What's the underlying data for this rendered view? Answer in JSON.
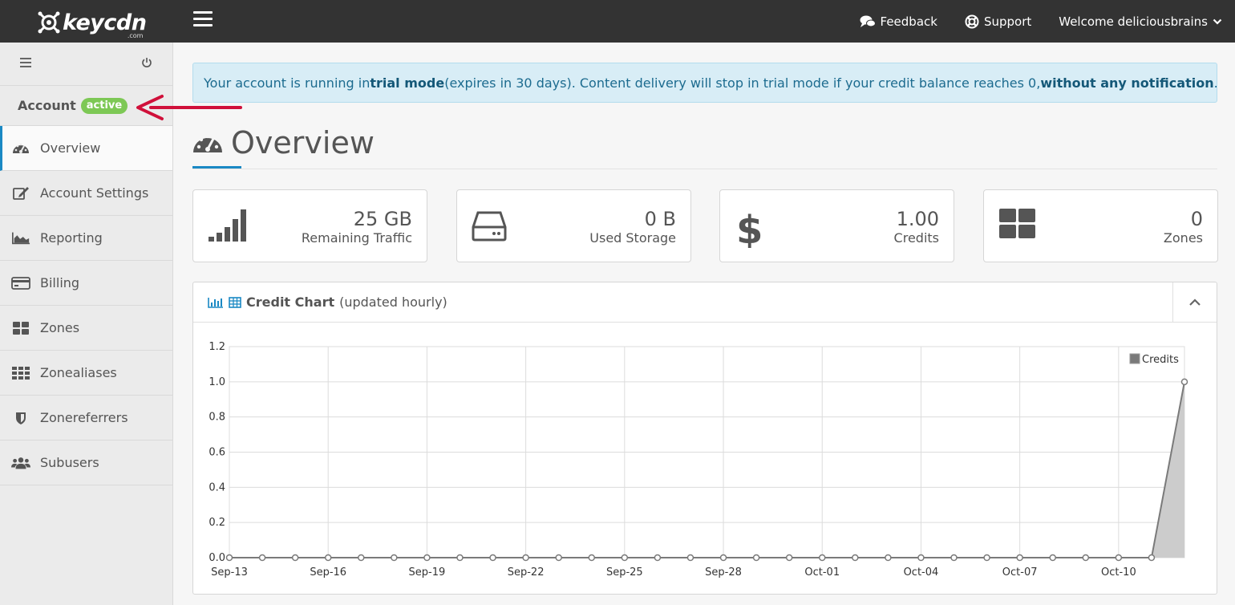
{
  "topbar": {
    "logo_text": "keycdn",
    "logo_sub": ".com",
    "feedback": "Feedback",
    "support": "Support",
    "welcome": "Welcome deliciousbrains"
  },
  "sidebar": {
    "account_label": "Account",
    "account_status": "active",
    "items": [
      {
        "label": "Overview",
        "icon": "dashboard-icon"
      },
      {
        "label": "Account Settings",
        "icon": "edit-icon"
      },
      {
        "label": "Reporting",
        "icon": "area-chart-icon"
      },
      {
        "label": "Billing",
        "icon": "credit-card-icon"
      },
      {
        "label": "Zones",
        "icon": "grid-icon"
      },
      {
        "label": "Zonealiases",
        "icon": "grid-dots-icon"
      },
      {
        "label": "Zonereferrers",
        "icon": "shield-icon"
      },
      {
        "label": "Subusers",
        "icon": "users-icon"
      }
    ]
  },
  "alert": {
    "p1": "Your account is running in ",
    "b1": "trial mode",
    "p2": " (expires in 30 days). Content delivery will stop in trial mode if your credit balance reaches 0, ",
    "b2": "without any notification",
    "p3": "."
  },
  "page": {
    "title": "Overview"
  },
  "stats": [
    {
      "value": "25 GB",
      "label": "Remaining Traffic",
      "icon": "signal-bars-icon"
    },
    {
      "value": "0 B",
      "label": "Used Storage",
      "icon": "hard-drive-icon"
    },
    {
      "value": "1.00",
      "label": "Credits",
      "icon": "dollar-icon"
    },
    {
      "value": "0",
      "label": "Zones",
      "icon": "zones-grid-icon"
    }
  ],
  "chart_panel": {
    "title": "Credit Chart",
    "subtitle": "(updated hourly)"
  },
  "chart_data": {
    "type": "area",
    "series": [
      {
        "name": "Credits",
        "values": [
          0,
          0,
          0,
          0,
          0,
          0,
          0,
          0,
          0,
          0,
          0,
          0,
          0,
          0,
          0,
          0,
          0,
          0,
          0,
          0,
          0,
          0,
          0,
          0,
          0,
          0,
          0,
          0,
          0,
          1.0
        ]
      }
    ],
    "x": [
      "Sep-13",
      "Sep-14",
      "Sep-15",
      "Sep-16",
      "Sep-17",
      "Sep-18",
      "Sep-19",
      "Sep-20",
      "Sep-21",
      "Sep-22",
      "Sep-23",
      "Sep-24",
      "Sep-25",
      "Sep-26",
      "Sep-27",
      "Sep-28",
      "Sep-29",
      "Sep-30",
      "Oct-01",
      "Oct-02",
      "Oct-03",
      "Oct-04",
      "Oct-05",
      "Oct-06",
      "Oct-07",
      "Oct-08",
      "Oct-09",
      "Oct-10",
      "Oct-11",
      "Oct-12"
    ],
    "x_tick_labels": [
      "Sep-13",
      "Sep-16",
      "Sep-19",
      "Sep-22",
      "Sep-25",
      "Sep-28",
      "Oct-01",
      "Oct-04",
      "Oct-07",
      "Oct-10"
    ],
    "y_tick_labels": [
      "0.0",
      "0.2",
      "0.4",
      "0.6",
      "0.8",
      "1.0",
      "1.2"
    ],
    "ylim": [
      0,
      1.2
    ],
    "grid": true,
    "legend": "top-right",
    "colors": {
      "line": "#7a7a7a",
      "fill": "#cccccc",
      "marker": "#ffffff"
    }
  }
}
